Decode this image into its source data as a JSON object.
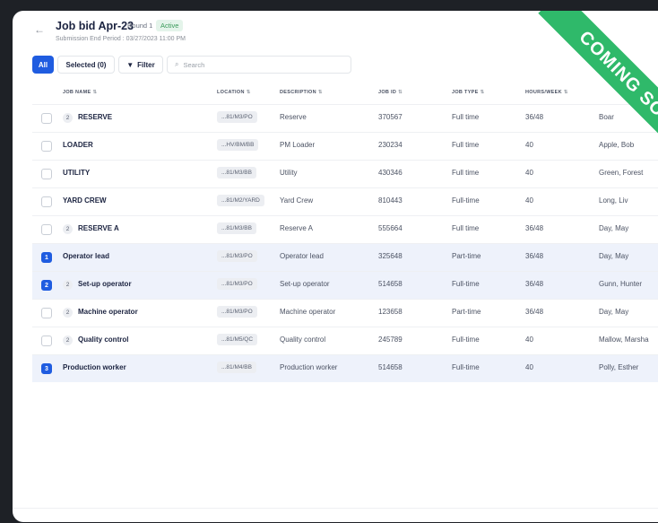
{
  "header": {
    "title": "Job bid Apr-23",
    "round": "Round 1",
    "status": "Active",
    "subtitle": "Submission End Period : 03/27/2023 11:00 PM"
  },
  "toolbar": {
    "all_label": "All",
    "selected_label": "Selected (0)",
    "filter_label": "Filter",
    "search_placeholder": "Search"
  },
  "table": {
    "columns": {
      "name": "JOB NAME",
      "location": "LOCATION",
      "description": "DESCRIPTION",
      "job_id": "JOB ID",
      "job_type": "JOB TYPE",
      "hours": "HOURS/WEEK"
    },
    "rows": [
      {
        "count": "2",
        "name": "RESERVE",
        "location": "...81/M3/PO",
        "description": "Reserve",
        "job_id": "370567",
        "job_type": "Full time",
        "hours": "36/48",
        "owner": "Boar",
        "checked": false,
        "num": ""
      },
      {
        "count": "",
        "name": "LOADER",
        "location": "...HV/BM/BB",
        "description": "PM Loader",
        "job_id": "230234",
        "job_type": "Full time",
        "hours": "40",
        "owner": "Apple, Bob",
        "checked": false,
        "num": ""
      },
      {
        "count": "",
        "name": "UTILITY",
        "location": "...81/M3/BB",
        "description": "Utility",
        "job_id": "430346",
        "job_type": "Full time",
        "hours": "40",
        "owner": "Green, Forest",
        "checked": false,
        "num": ""
      },
      {
        "count": "",
        "name": "YARD CREW",
        "location": "...81/M2/YARD",
        "description": "Yard Crew",
        "job_id": "810443",
        "job_type": "Full-time",
        "hours": "40",
        "owner": "Long, Liv",
        "checked": false,
        "num": ""
      },
      {
        "count": "2",
        "name": "RESERVE A",
        "location": "...81/M3/BB",
        "description": "Reserve A",
        "job_id": "555664",
        "job_type": "Full time",
        "hours": "36/48",
        "owner": "Day, May",
        "checked": false,
        "num": ""
      },
      {
        "count": "",
        "name": "Operator lead",
        "location": "...81/M3/PO",
        "description": "Operator lead",
        "job_id": "325648",
        "job_type": "Part-time",
        "hours": "36/48",
        "owner": "Day, May",
        "checked": true,
        "num": "1"
      },
      {
        "count": "2",
        "name": "Set-up operator",
        "location": "...81/M3/PO",
        "description": "Set-up operator",
        "job_id": "514658",
        "job_type": "Full-time",
        "hours": "36/48",
        "owner": "Gunn, Hunter",
        "checked": true,
        "num": "2"
      },
      {
        "count": "2",
        "name": "Machine operator",
        "location": "...81/M3/PO",
        "description": "Machine operator",
        "job_id": "123658",
        "job_type": "Part-time",
        "hours": "36/48",
        "owner": "Day, May",
        "checked": false,
        "num": ""
      },
      {
        "count": "2",
        "name": "Quality control",
        "location": "...81/M5/QC",
        "description": "Quality control",
        "job_id": "245789",
        "job_type": "Full-time",
        "hours": "40",
        "owner": "Mallow, Marsha",
        "checked": false,
        "num": ""
      },
      {
        "count": "",
        "name": "Production worker",
        "location": "...81/M4/BB",
        "description": "Production worker",
        "job_id": "514658",
        "job_type": "Full-time",
        "hours": "40",
        "owner": "Polly, Esther",
        "checked": true,
        "num": "3"
      }
    ]
  },
  "ribbon": {
    "text": "COMING SOON",
    "color": "#2fb96a"
  },
  "icons": {
    "back": "arrow-left-icon",
    "filter": "filter-icon",
    "search": "search-icon",
    "sort": "sort-icon"
  },
  "colors": {
    "accent": "#1f5ce0",
    "active_badge": "#3a9a5a",
    "selected_row": "#eef2fb"
  }
}
